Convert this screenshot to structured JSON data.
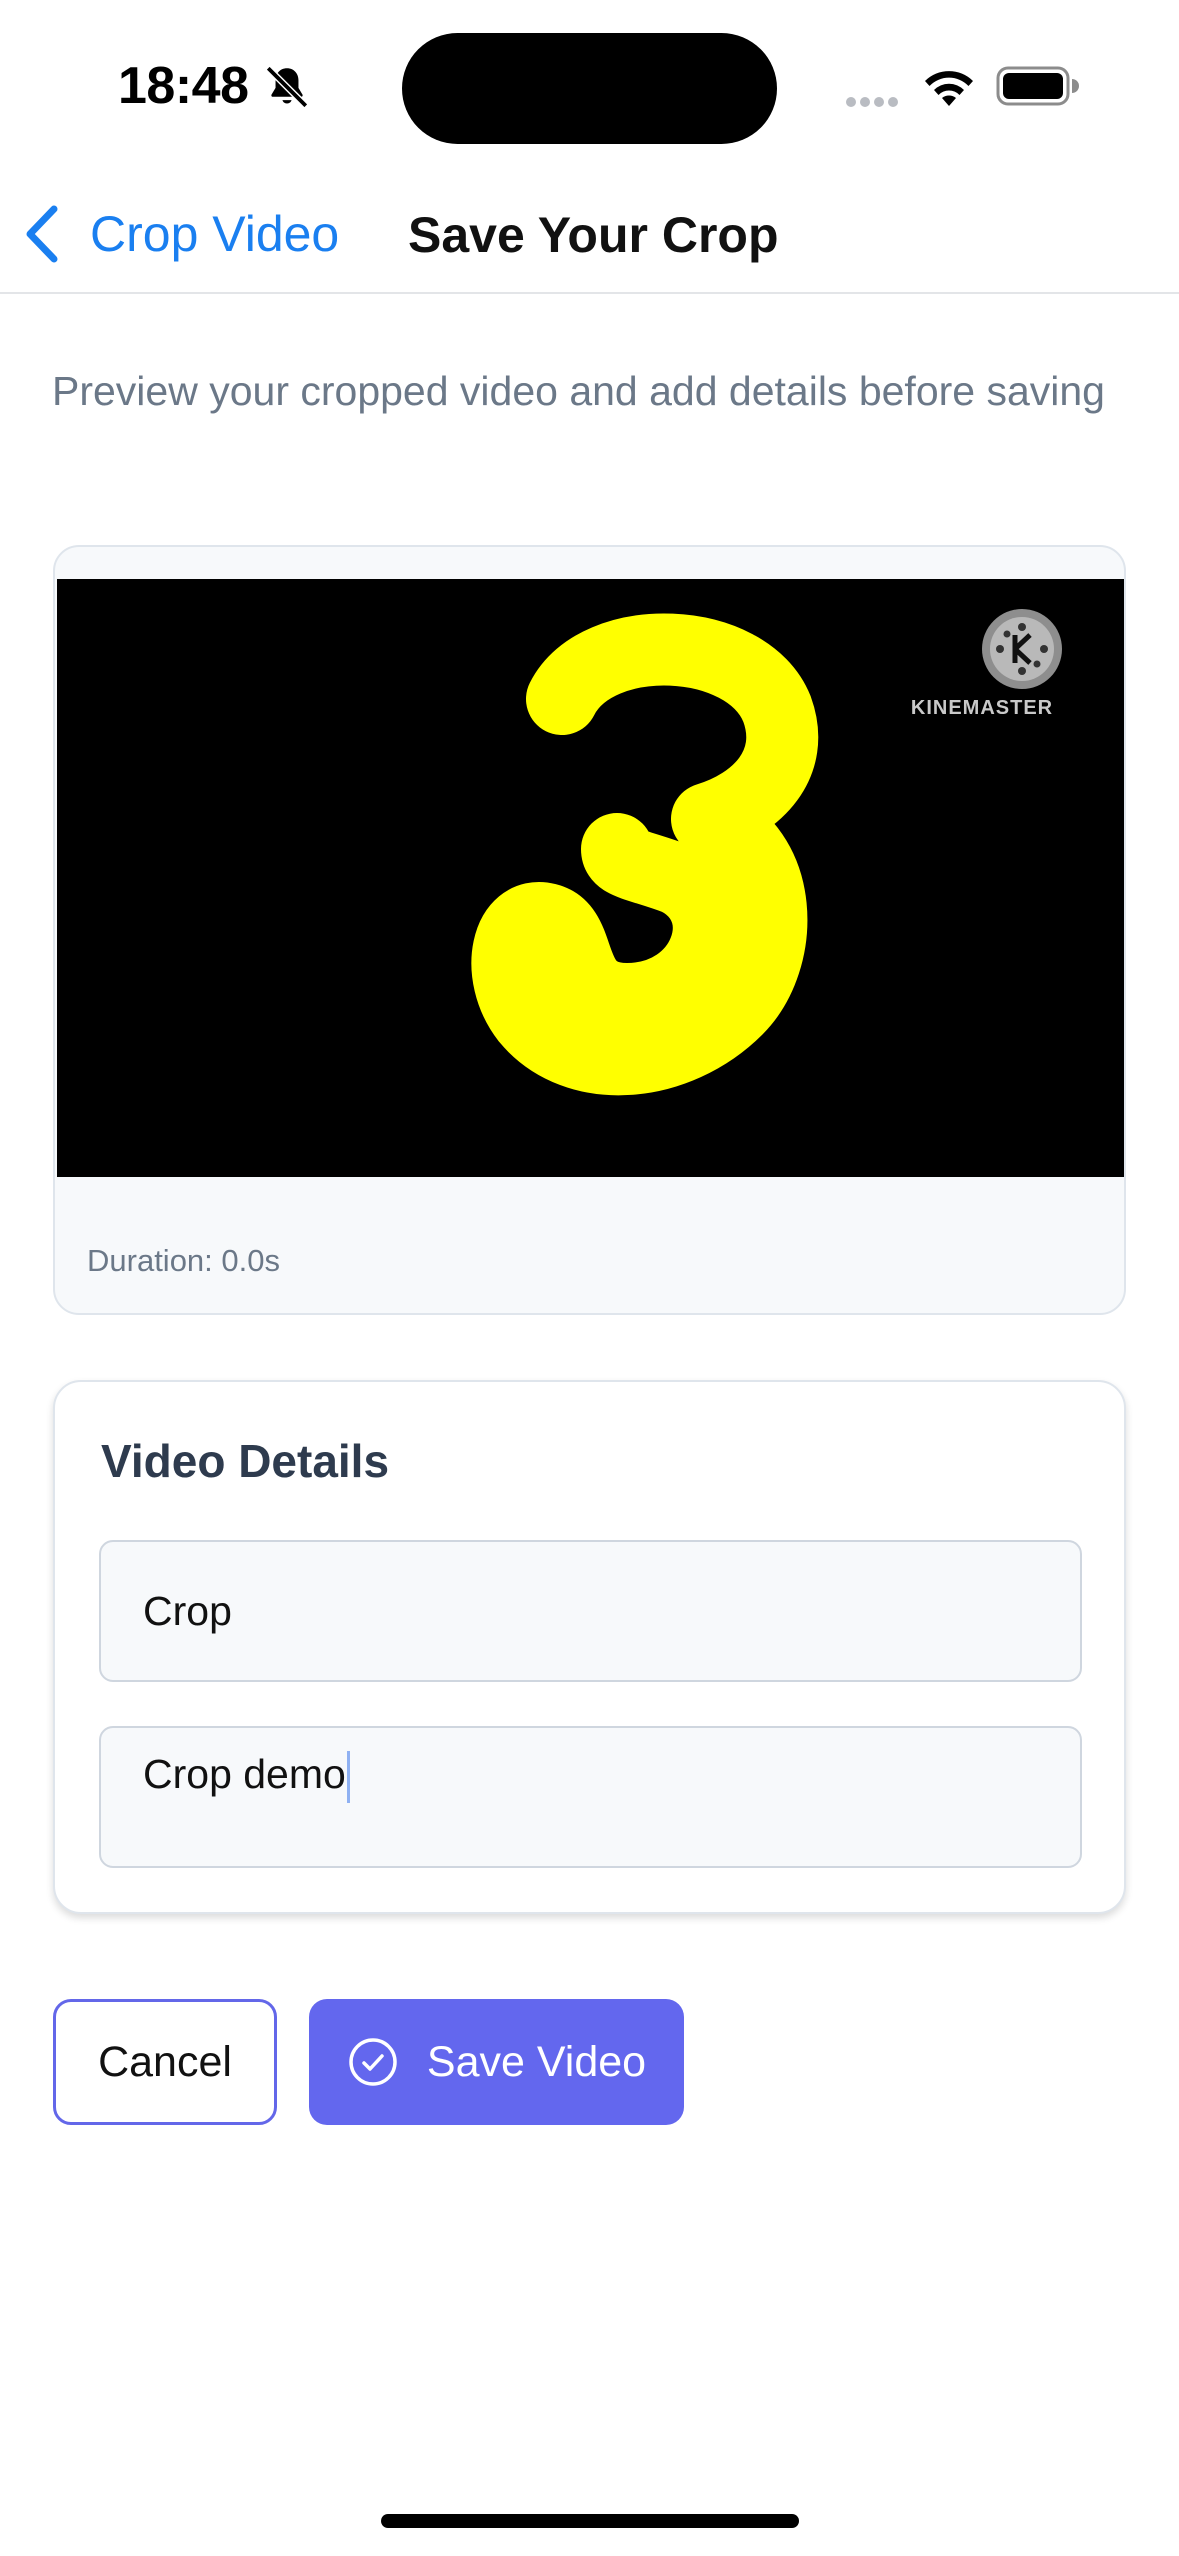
{
  "status_bar": {
    "time": "18:48",
    "icons": [
      "bell-slash-icon",
      "signal-dots-icon",
      "wifi-icon",
      "battery-icon"
    ]
  },
  "nav": {
    "back_label": "Crop Video",
    "title": "Save Your Crop",
    "accent_color": "#1a7ff0"
  },
  "intro": {
    "subtitle": "Preview your cropped video and add details before saving"
  },
  "preview": {
    "watermark": "KINEMASTER",
    "duration": "Duration: 0.0s"
  },
  "details": {
    "heading": "Video Details",
    "title_value": "Crop",
    "description_value": "Crop demo"
  },
  "actions": {
    "cancel_label": "Cancel",
    "save_label": "Save Video",
    "save_color": "#6367ee"
  }
}
